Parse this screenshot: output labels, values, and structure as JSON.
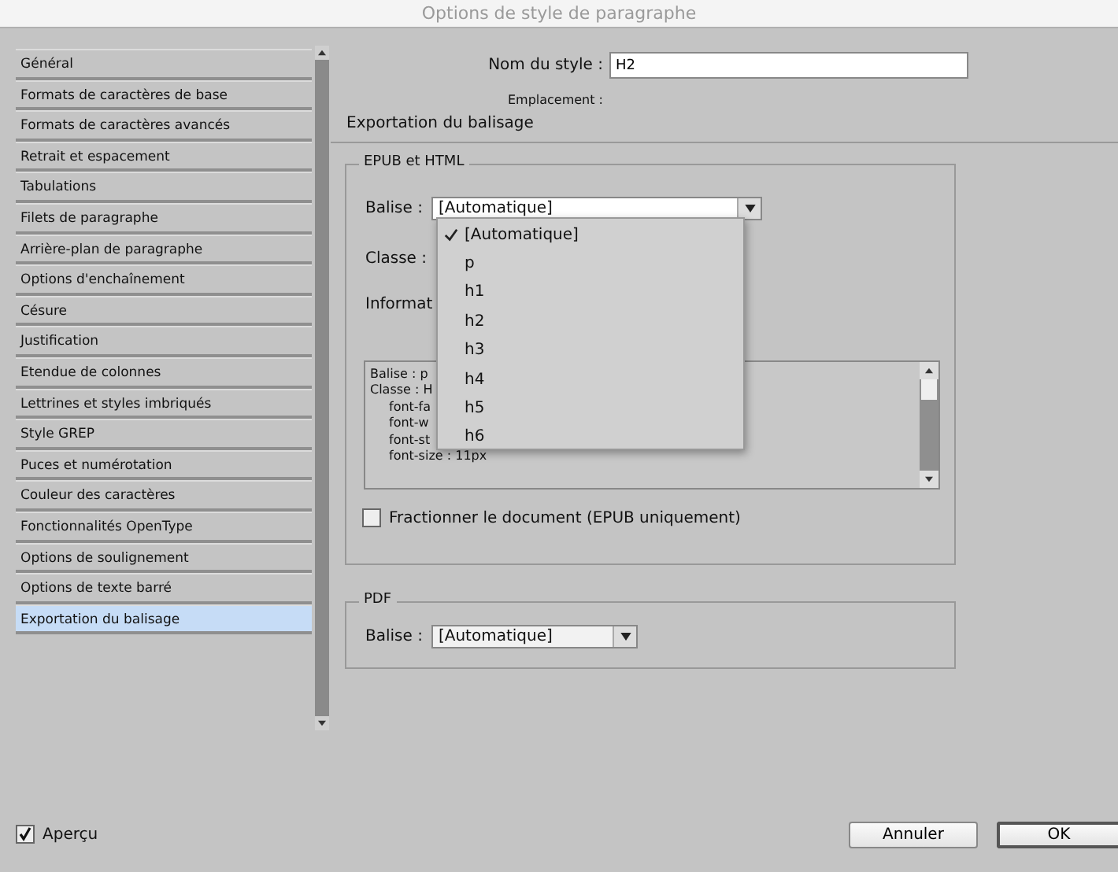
{
  "window": {
    "title": "Options de style de paragraphe"
  },
  "sidebar": {
    "items": [
      {
        "label": "Général",
        "selected": false
      },
      {
        "label": "Formats de caractères de base",
        "selected": false
      },
      {
        "label": "Formats de caractères avancés",
        "selected": false
      },
      {
        "label": "Retrait et espacement",
        "selected": false
      },
      {
        "label": "Tabulations",
        "selected": false
      },
      {
        "label": "Filets de paragraphe",
        "selected": false
      },
      {
        "label": "Arrière-plan de paragraphe",
        "selected": false
      },
      {
        "label": "Options d'enchaînement",
        "selected": false
      },
      {
        "label": "Césure",
        "selected": false
      },
      {
        "label": "Justification",
        "selected": false
      },
      {
        "label": "Etendue de colonnes",
        "selected": false
      },
      {
        "label": "Lettrines et styles imbriqués",
        "selected": false
      },
      {
        "label": "Style GREP",
        "selected": false
      },
      {
        "label": "Puces et numérotation",
        "selected": false
      },
      {
        "label": "Couleur des caractères",
        "selected": false
      },
      {
        "label": "Fonctionnalités OpenType",
        "selected": false
      },
      {
        "label": "Options de soulignement",
        "selected": false
      },
      {
        "label": "Options de texte barré",
        "selected": false
      },
      {
        "label": "Exportation du balisage",
        "selected": true
      }
    ]
  },
  "style_name": {
    "label": "Nom du style :",
    "value": "H2"
  },
  "location": {
    "label": "Emplacement :"
  },
  "section_title": "Exportation du balisage",
  "epub_html": {
    "legend": "EPUB et HTML",
    "tag": {
      "label": "Balise :",
      "value": "[Automatique]",
      "expanded": true,
      "options": [
        {
          "label": "[Automatique]",
          "selected": true
        },
        {
          "label": "p",
          "selected": false
        },
        {
          "label": "h1",
          "selected": false
        },
        {
          "label": "h2",
          "selected": false
        },
        {
          "label": "h3",
          "selected": false
        },
        {
          "label": "h4",
          "selected": false
        },
        {
          "label": "h5",
          "selected": false
        },
        {
          "label": "h6",
          "selected": false
        }
      ]
    },
    "class": {
      "label": "Classe :"
    },
    "info": {
      "label": "Informat",
      "lines": [
        {
          "text": "Balise : p",
          "kind": "heading"
        },
        {
          "text": "Classe : H",
          "kind": "heading"
        },
        {
          "text": "font-fa",
          "kind": "property"
        },
        {
          "text": "font-w",
          "kind": "property"
        },
        {
          "text": "font-st",
          "kind": "property"
        },
        {
          "text": "font-size : 11px",
          "kind": "property"
        }
      ]
    },
    "split_document": {
      "label": "Fractionner le document (EPUB uniquement)",
      "checked": false
    }
  },
  "pdf": {
    "legend": "PDF",
    "tag": {
      "label": "Balise :",
      "value": "[Automatique]"
    }
  },
  "preview": {
    "label": "Aperçu",
    "checked": true
  },
  "buttons": [
    {
      "label": "Annuler",
      "kind": "normal"
    },
    {
      "label": "OK",
      "kind": "default"
    }
  ]
}
